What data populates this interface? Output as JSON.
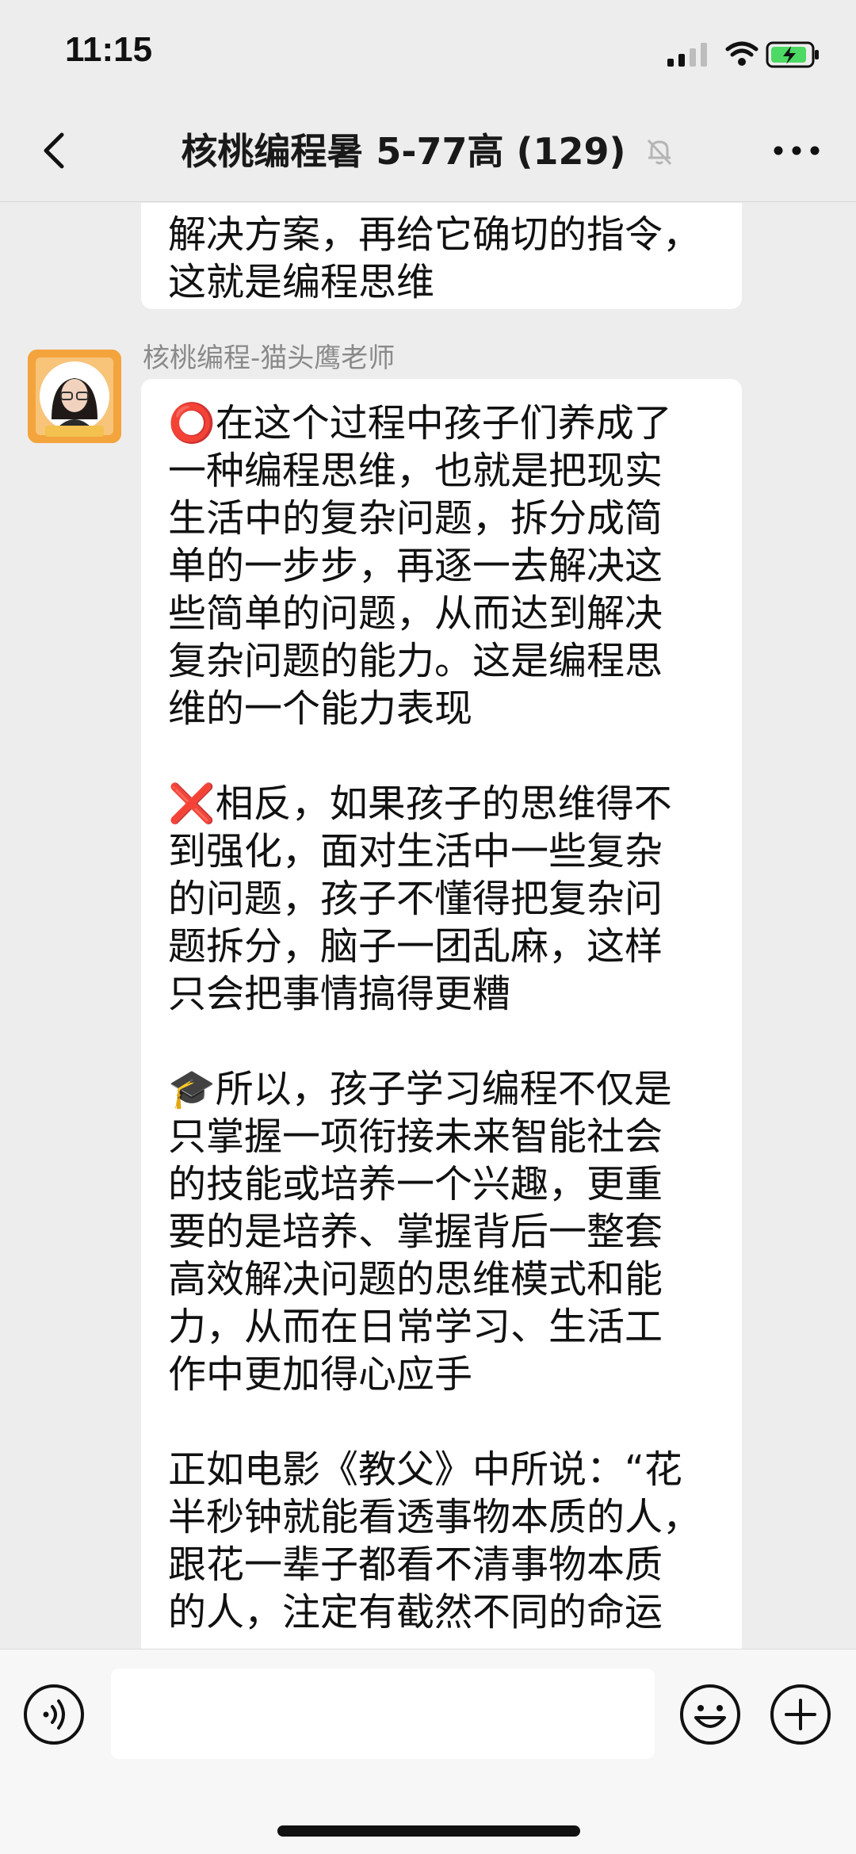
{
  "status_bar": {
    "time": "11:15"
  },
  "nav": {
    "title": "核桃编程暑 5-77高 (129)"
  },
  "messages": {
    "previous_text": "解决方案，再给它确切的指令，\n这就是编程思维",
    "sender": "核桃编程-猫头鹰老师",
    "avatar_badge": "猫头鹰老师",
    "main_text": "⭕在这个过程中孩子们养成了\n一种编程思维，也就是把现实\n生活中的复杂问题，拆分成简\n单的一步步，再逐一去解决这\n些简单的问题，从而达到解决\n复杂问题的能力。这是编程思\n维的一个能力表现\n\n❌相反，如果孩子的思维得不\n到强化，面对生活中一些复杂\n的问题，孩子不懂得把复杂问\n题拆分，脑子一团乱麻，这样\n只会把事情搞得更糟\n\n🎓所以，孩子学习编程不仅是\n只掌握一项衔接未来智能社会\n的技能或培养一个兴趣，更重\n要的是培养、掌握背后一整套\n高效解决问题的思维模式和能\n力，从而在日常学习、生活工\n作中更加得心应手\n\n正如电影《教父》中所说：“花\n半秒钟就能看透事物本质的人，\n跟花一辈子都看不清事物本质\n的人，注定有截然不同的命运"
  },
  "input": {
    "value": ""
  },
  "icons": {
    "back": "chevron-left-icon",
    "mute": "bell-muted-icon",
    "more": "more-dots-icon",
    "voice": "voice-icon",
    "emoji": "emoji-icon",
    "plus": "plus-icon"
  }
}
